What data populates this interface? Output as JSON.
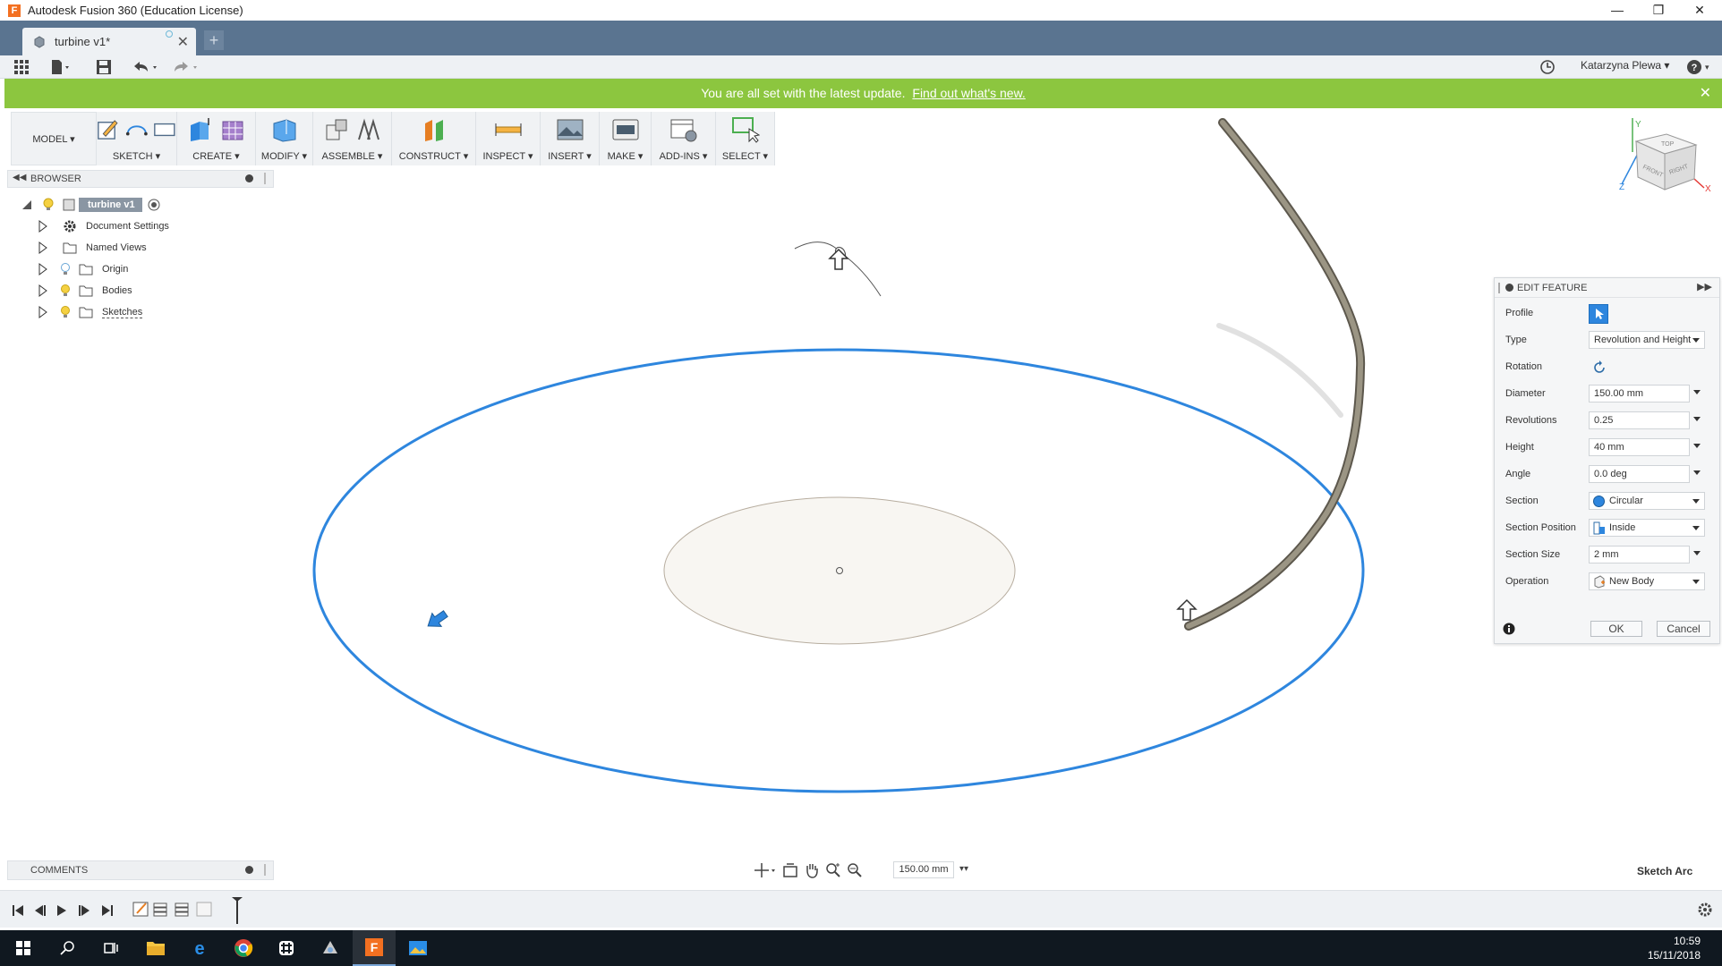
{
  "window": {
    "title": "Autodesk Fusion 360 (Education License)",
    "app_icon_letter": "F"
  },
  "tabs": {
    "document_tab_label": "turbine v1*",
    "new_tab_symbol": "+"
  },
  "quick_access": {
    "user_name": "Katarzyna Plewa ▾",
    "help_label": "?"
  },
  "banner": {
    "message": "You are all set with the latest update.",
    "link_text": "Find out what's new."
  },
  "toolbar": {
    "workspace_label": "MODEL ▾",
    "groups": [
      {
        "label": "SKETCH ▾"
      },
      {
        "label": "CREATE ▾"
      },
      {
        "label": "MODIFY ▾"
      },
      {
        "label": "ASSEMBLE ▾"
      },
      {
        "label": "CONSTRUCT ▾"
      },
      {
        "label": "INSPECT ▾"
      },
      {
        "label": "INSERT ▾"
      },
      {
        "label": "MAKE ▾"
      },
      {
        "label": "ADD-INS ▾"
      },
      {
        "label": "SELECT ▾"
      }
    ]
  },
  "browser": {
    "header": "BROWSER",
    "root": "turbine v1",
    "items": [
      {
        "label": "Document Settings",
        "icon": "gear-icon"
      },
      {
        "label": "Named Views",
        "icon": "folder-icon"
      },
      {
        "label": "Origin",
        "icon": "folder-icon"
      },
      {
        "label": "Bodies",
        "icon": "folder-icon"
      },
      {
        "label": "Sketches",
        "icon": "folder-icon"
      }
    ]
  },
  "viewcube": {
    "faces": [
      "TOP",
      "FRONT",
      "RIGHT"
    ],
    "axis_labels": [
      "Y",
      "Z",
      "X"
    ]
  },
  "edit_feature": {
    "title": "EDIT FEATURE",
    "rows": {
      "profile": {
        "label": "Profile"
      },
      "type": {
        "label": "Type",
        "value": "Revolution and Height"
      },
      "rotation": {
        "label": "Rotation"
      },
      "diameter": {
        "label": "Diameter",
        "value": "150.00 mm"
      },
      "revolutions": {
        "label": "Revolutions",
        "value": "0.25"
      },
      "height": {
        "label": "Height",
        "value": "40 mm"
      },
      "angle": {
        "label": "Angle",
        "value": "0.0 deg"
      },
      "section": {
        "label": "Section",
        "value": "Circular"
      },
      "section_position": {
        "label": "Section Position",
        "value": "Inside"
      },
      "section_size": {
        "label": "Section Size",
        "value": "2 mm"
      },
      "operation": {
        "label": "Operation",
        "value": "New Body"
      }
    },
    "ok_label": "OK",
    "cancel_label": "Cancel"
  },
  "comments": {
    "label": "COMMENTS"
  },
  "navbar": {
    "zoom_value": "150.00 mm"
  },
  "status": {
    "text": "Sketch Arc"
  },
  "taskbar": {
    "time": "10:59",
    "date": "15/11/2018"
  },
  "colors": {
    "tabbar": "#5a7490",
    "banner": "#8cc63f",
    "selection_blue": "#2e86de",
    "sweep_body": "#8b8676"
  }
}
